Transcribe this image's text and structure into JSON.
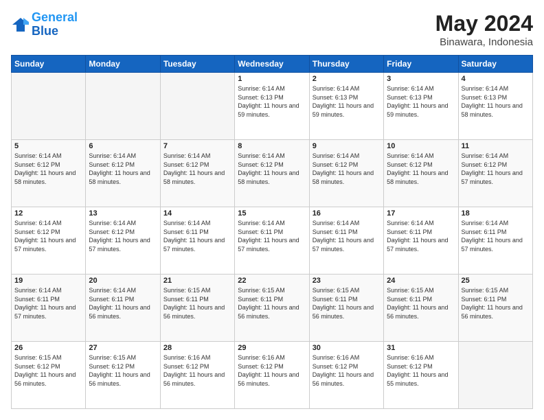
{
  "header": {
    "logo_line1": "General",
    "logo_line2": "Blue",
    "main_title": "May 2024",
    "subtitle": "Binawara, Indonesia"
  },
  "calendar": {
    "days_of_week": [
      "Sunday",
      "Monday",
      "Tuesday",
      "Wednesday",
      "Thursday",
      "Friday",
      "Saturday"
    ],
    "weeks": [
      [
        {
          "day": "",
          "info": ""
        },
        {
          "day": "",
          "info": ""
        },
        {
          "day": "",
          "info": ""
        },
        {
          "day": "1",
          "info": "Sunrise: 6:14 AM\nSunset: 6:13 PM\nDaylight: 11 hours and 59 minutes."
        },
        {
          "day": "2",
          "info": "Sunrise: 6:14 AM\nSunset: 6:13 PM\nDaylight: 11 hours and 59 minutes."
        },
        {
          "day": "3",
          "info": "Sunrise: 6:14 AM\nSunset: 6:13 PM\nDaylight: 11 hours and 59 minutes."
        },
        {
          "day": "4",
          "info": "Sunrise: 6:14 AM\nSunset: 6:13 PM\nDaylight: 11 hours and 58 minutes."
        }
      ],
      [
        {
          "day": "5",
          "info": "Sunrise: 6:14 AM\nSunset: 6:12 PM\nDaylight: 11 hours and 58 minutes."
        },
        {
          "day": "6",
          "info": "Sunrise: 6:14 AM\nSunset: 6:12 PM\nDaylight: 11 hours and 58 minutes."
        },
        {
          "day": "7",
          "info": "Sunrise: 6:14 AM\nSunset: 6:12 PM\nDaylight: 11 hours and 58 minutes."
        },
        {
          "day": "8",
          "info": "Sunrise: 6:14 AM\nSunset: 6:12 PM\nDaylight: 11 hours and 58 minutes."
        },
        {
          "day": "9",
          "info": "Sunrise: 6:14 AM\nSunset: 6:12 PM\nDaylight: 11 hours and 58 minutes."
        },
        {
          "day": "10",
          "info": "Sunrise: 6:14 AM\nSunset: 6:12 PM\nDaylight: 11 hours and 58 minutes."
        },
        {
          "day": "11",
          "info": "Sunrise: 6:14 AM\nSunset: 6:12 PM\nDaylight: 11 hours and 57 minutes."
        }
      ],
      [
        {
          "day": "12",
          "info": "Sunrise: 6:14 AM\nSunset: 6:12 PM\nDaylight: 11 hours and 57 minutes."
        },
        {
          "day": "13",
          "info": "Sunrise: 6:14 AM\nSunset: 6:12 PM\nDaylight: 11 hours and 57 minutes."
        },
        {
          "day": "14",
          "info": "Sunrise: 6:14 AM\nSunset: 6:11 PM\nDaylight: 11 hours and 57 minutes."
        },
        {
          "day": "15",
          "info": "Sunrise: 6:14 AM\nSunset: 6:11 PM\nDaylight: 11 hours and 57 minutes."
        },
        {
          "day": "16",
          "info": "Sunrise: 6:14 AM\nSunset: 6:11 PM\nDaylight: 11 hours and 57 minutes."
        },
        {
          "day": "17",
          "info": "Sunrise: 6:14 AM\nSunset: 6:11 PM\nDaylight: 11 hours and 57 minutes."
        },
        {
          "day": "18",
          "info": "Sunrise: 6:14 AM\nSunset: 6:11 PM\nDaylight: 11 hours and 57 minutes."
        }
      ],
      [
        {
          "day": "19",
          "info": "Sunrise: 6:14 AM\nSunset: 6:11 PM\nDaylight: 11 hours and 57 minutes."
        },
        {
          "day": "20",
          "info": "Sunrise: 6:14 AM\nSunset: 6:11 PM\nDaylight: 11 hours and 56 minutes."
        },
        {
          "day": "21",
          "info": "Sunrise: 6:15 AM\nSunset: 6:11 PM\nDaylight: 11 hours and 56 minutes."
        },
        {
          "day": "22",
          "info": "Sunrise: 6:15 AM\nSunset: 6:11 PM\nDaylight: 11 hours and 56 minutes."
        },
        {
          "day": "23",
          "info": "Sunrise: 6:15 AM\nSunset: 6:11 PM\nDaylight: 11 hours and 56 minutes."
        },
        {
          "day": "24",
          "info": "Sunrise: 6:15 AM\nSunset: 6:11 PM\nDaylight: 11 hours and 56 minutes."
        },
        {
          "day": "25",
          "info": "Sunrise: 6:15 AM\nSunset: 6:11 PM\nDaylight: 11 hours and 56 minutes."
        }
      ],
      [
        {
          "day": "26",
          "info": "Sunrise: 6:15 AM\nSunset: 6:12 PM\nDaylight: 11 hours and 56 minutes."
        },
        {
          "day": "27",
          "info": "Sunrise: 6:15 AM\nSunset: 6:12 PM\nDaylight: 11 hours and 56 minutes."
        },
        {
          "day": "28",
          "info": "Sunrise: 6:16 AM\nSunset: 6:12 PM\nDaylight: 11 hours and 56 minutes."
        },
        {
          "day": "29",
          "info": "Sunrise: 6:16 AM\nSunset: 6:12 PM\nDaylight: 11 hours and 56 minutes."
        },
        {
          "day": "30",
          "info": "Sunrise: 6:16 AM\nSunset: 6:12 PM\nDaylight: 11 hours and 56 minutes."
        },
        {
          "day": "31",
          "info": "Sunrise: 6:16 AM\nSunset: 6:12 PM\nDaylight: 11 hours and 55 minutes."
        },
        {
          "day": "",
          "info": ""
        }
      ]
    ]
  }
}
